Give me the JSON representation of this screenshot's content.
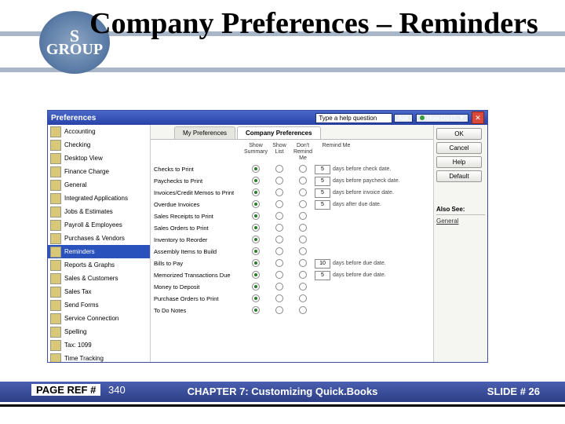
{
  "title": "Company Preferences – Reminders",
  "logo": {
    "top": "S",
    "bottom": "GROUP"
  },
  "titlebar": {
    "title": "Preferences",
    "help_placeholder": "Type a help question",
    "ask": "Ask",
    "howdoi": "How Do I?"
  },
  "sidebar": {
    "items": [
      {
        "label": "Accounting"
      },
      {
        "label": "Checking"
      },
      {
        "label": "Desktop View"
      },
      {
        "label": "Finance Charge"
      },
      {
        "label": "General"
      },
      {
        "label": "Integrated Applications"
      },
      {
        "label": "Jobs & Estimates"
      },
      {
        "label": "Payroll & Employees"
      },
      {
        "label": "Purchases & Vendors"
      },
      {
        "label": "Reminders",
        "selected": true
      },
      {
        "label": "Reports & Graphs"
      },
      {
        "label": "Sales & Customers"
      },
      {
        "label": "Sales Tax"
      },
      {
        "label": "Send Forms"
      },
      {
        "label": "Service Connection"
      },
      {
        "label": "Spelling"
      },
      {
        "label": "Tax: 1099"
      },
      {
        "label": "Time Tracking"
      }
    ]
  },
  "tabs": {
    "my": "My Preferences",
    "company": "Company Preferences"
  },
  "columns": {
    "summary": "Show Summary",
    "list": "Show List",
    "dont": "Don't Remind Me",
    "remind": "Remind Me"
  },
  "rows": [
    {
      "label": "Checks to Print",
      "sel": 0,
      "days": "5",
      "after": "days before check date."
    },
    {
      "label": "Paychecks to Print",
      "sel": 0,
      "days": "5",
      "after": "days before paycheck date."
    },
    {
      "label": "Invoices/Credit Memos to Print",
      "sel": 0,
      "days": "5",
      "after": "days before invoice date."
    },
    {
      "label": "Overdue Invoices",
      "sel": 0,
      "days": "5",
      "after": "days after due date."
    },
    {
      "label": "Sales Receipts to Print",
      "sel": 0
    },
    {
      "label": "Sales Orders to Print",
      "sel": 0
    },
    {
      "label": "Inventory to Reorder",
      "sel": 0
    },
    {
      "label": "Assembly Items to Build",
      "sel": 0
    },
    {
      "label": "Bills to Pay",
      "sel": 0,
      "days": "10",
      "after": "days before due date."
    },
    {
      "label": "Memorized Transactions Due",
      "sel": 0,
      "days": "5",
      "after": "days before due date."
    },
    {
      "label": "Money to Deposit",
      "sel": 0
    },
    {
      "label": "Purchase Orders to Print",
      "sel": 0
    },
    {
      "label": "To Do Notes",
      "sel": 0
    }
  ],
  "buttons": {
    "ok": "OK",
    "cancel": "Cancel",
    "help": "Help",
    "default": "Default"
  },
  "also": {
    "title": "Also See:",
    "link": "General"
  },
  "footer": {
    "page_ref_label": "PAGE REF #",
    "page_ref_num": "340",
    "chapter": "CHAPTER 7: Customizing Quick.Books",
    "slide": "SLIDE # 26"
  }
}
